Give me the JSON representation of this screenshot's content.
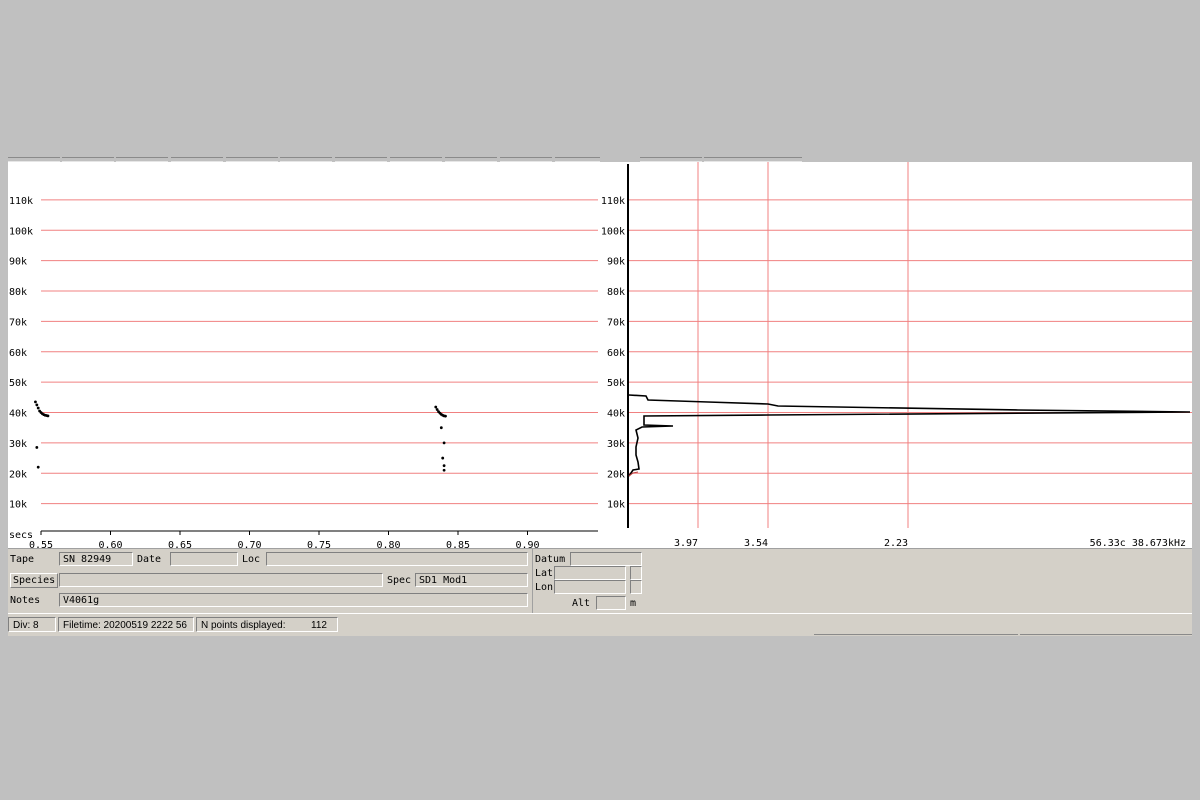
{
  "colors": {
    "grid": "#f08080",
    "trace": "#000000",
    "panel": "#d4d0c8",
    "background": "#c0c0c0"
  },
  "chart_data": [
    {
      "type": "scatter",
      "name_hint": "time-frequency",
      "y_tick_labels": [
        "10k",
        "20k",
        "30k",
        "40k",
        "50k",
        "60k",
        "70k",
        "80k",
        "90k",
        "100k",
        "110k"
      ],
      "x_unit_label": "secs",
      "x_ticks": [
        "0.55",
        "0.60",
        "0.65",
        "0.70",
        "0.75",
        "0.80",
        "0.85",
        "0.90"
      ],
      "xlim": [
        0.545,
        0.95
      ],
      "ylim": [
        0,
        120
      ],
      "grid": true,
      "calls": [
        {
          "points": [
            [
              0.546,
              43.5
            ],
            [
              0.547,
              42.5
            ],
            [
              0.548,
              41.5
            ],
            [
              0.549,
              40.5
            ],
            [
              0.55,
              40.0
            ],
            [
              0.551,
              39.6
            ],
            [
              0.552,
              39.3
            ],
            [
              0.553,
              39.1
            ],
            [
              0.554,
              39.0
            ],
            [
              0.555,
              38.9
            ]
          ]
        },
        {
          "points": [
            [
              0.547,
              28.5
            ],
            [
              0.548,
              22.0
            ]
          ]
        },
        {
          "points": [
            [
              0.834,
              41.8
            ],
            [
              0.835,
              41.0
            ],
            [
              0.836,
              40.3
            ],
            [
              0.837,
              39.8
            ],
            [
              0.838,
              39.4
            ],
            [
              0.839,
              39.1
            ],
            [
              0.84,
              38.9
            ],
            [
              0.841,
              38.8
            ]
          ]
        },
        {
          "points": [
            [
              0.838,
              35.0
            ],
            [
              0.84,
              30.0
            ],
            [
              0.839,
              25.0
            ],
            [
              0.84,
              22.5
            ],
            [
              0.84,
              21.0
            ]
          ]
        }
      ]
    },
    {
      "type": "line",
      "name_hint": "spectrum",
      "y_tick_labels": [
        "10k",
        "20k",
        "30k",
        "40k",
        "50k",
        "60k",
        "70k",
        "80k",
        "90k",
        "100k",
        "110k"
      ],
      "x_ticks": [
        "3.97",
        "3.54",
        "2.23"
      ],
      "readout": "56.33c 38.673kHz",
      "grid": true
    }
  ],
  "info": {
    "tape_label": "Tape",
    "tape_value": "SN 82949",
    "date_label": "Date",
    "date_value": "",
    "loc_label": "Loc",
    "loc_value": "",
    "species_button": "Species",
    "species_value": "",
    "spec_label": "Spec",
    "spec_value": "SD1 Mod1",
    "notes_label": "Notes",
    "notes_value": "V4061g",
    "datum_label": "Datum",
    "datum_value": "",
    "lat_label": "Lat",
    "lat_value": "",
    "lon_label": "Lon",
    "lon_value": "",
    "alt_label": "Alt",
    "alt_value": "",
    "alt_unit": "m"
  },
  "status": {
    "div": "Div: 8",
    "filetime": "Filetime: 20200519 2222 56",
    "npoints_label": "N points displayed:",
    "npoints_value": "112"
  }
}
